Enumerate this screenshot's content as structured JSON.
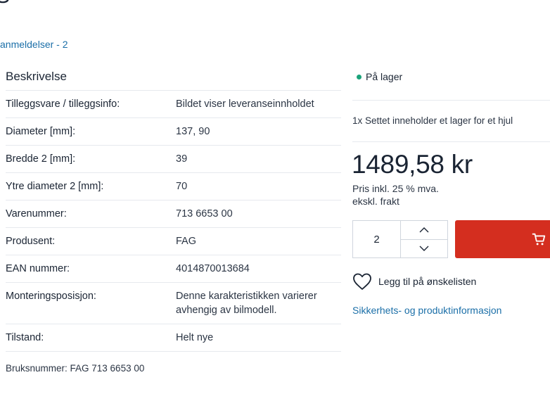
{
  "header": {
    "title_fragment": "S",
    "reviews_link": "anmeldelser - 2"
  },
  "description": {
    "heading": "Beskrivelse",
    "specs": [
      {
        "label": "Tilleggsvare / tilleggsinfo:",
        "value": "Bildet viser leveranseinnholdet"
      },
      {
        "label": "Diameter [mm]:",
        "value": "137, 90"
      },
      {
        "label": "Bredde 2 [mm]:",
        "value": "39"
      },
      {
        "label": "Ytre diameter 2 [mm]:",
        "value": "70"
      },
      {
        "label": "Varenummer:",
        "value": "713 6653 00"
      },
      {
        "label": "Produsent:",
        "value": "FAG"
      },
      {
        "label": "EAN nummer:",
        "value": "4014870013684"
      },
      {
        "label": "Monteringsposisjon:",
        "value": "Denne karakteristikken varierer avhengig av bilmodell."
      },
      {
        "label": "Tilstand:",
        "value": "Helt nye"
      }
    ],
    "usage_number": "Bruksnummer: FAG 713 6653 00"
  },
  "purchase": {
    "stock_status": "På lager",
    "stock_color": "#1aa37a",
    "set_note": "1x Settet inneholder et lager for et hjul",
    "price": "1489,58 kr",
    "vat_line1": "Pris inkl. 25 % mva.",
    "vat_line2": "ekskl. frakt",
    "quantity": "2",
    "cart_icon": "cart-icon",
    "cart_color": "#d42e1f",
    "wishlist_label": "Legg til på ønskelisten",
    "safety_link": "Sikkerhets- og produktinformasjon"
  }
}
